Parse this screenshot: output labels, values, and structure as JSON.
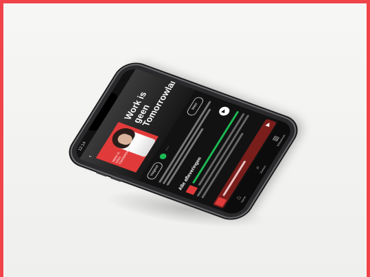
{
  "scene": {
    "border_color": "#f0434a",
    "background_color": "#f3f3f1"
  },
  "phone_screen": {
    "status_time": "12:14",
    "podcast": {
      "title": "Work is geen Tomorrowland",
      "publisher": "",
      "cover_text": "WERK IS GEEN TOMORROWLAND"
    },
    "buttons": {
      "follow": "Volgend",
      "about": "Meer"
    },
    "section_title": "Alle afleveringen",
    "tabs": [
      {
        "icon": "home-icon",
        "label": "Home"
      },
      {
        "icon": "search-icon",
        "label": "Zoeken"
      },
      {
        "icon": "library-icon",
        "label": "Bibliotheek"
      }
    ],
    "colors": {
      "accent": "#1db954",
      "cover": "#e03b3a",
      "mini_player": "#7a1e1c"
    }
  }
}
